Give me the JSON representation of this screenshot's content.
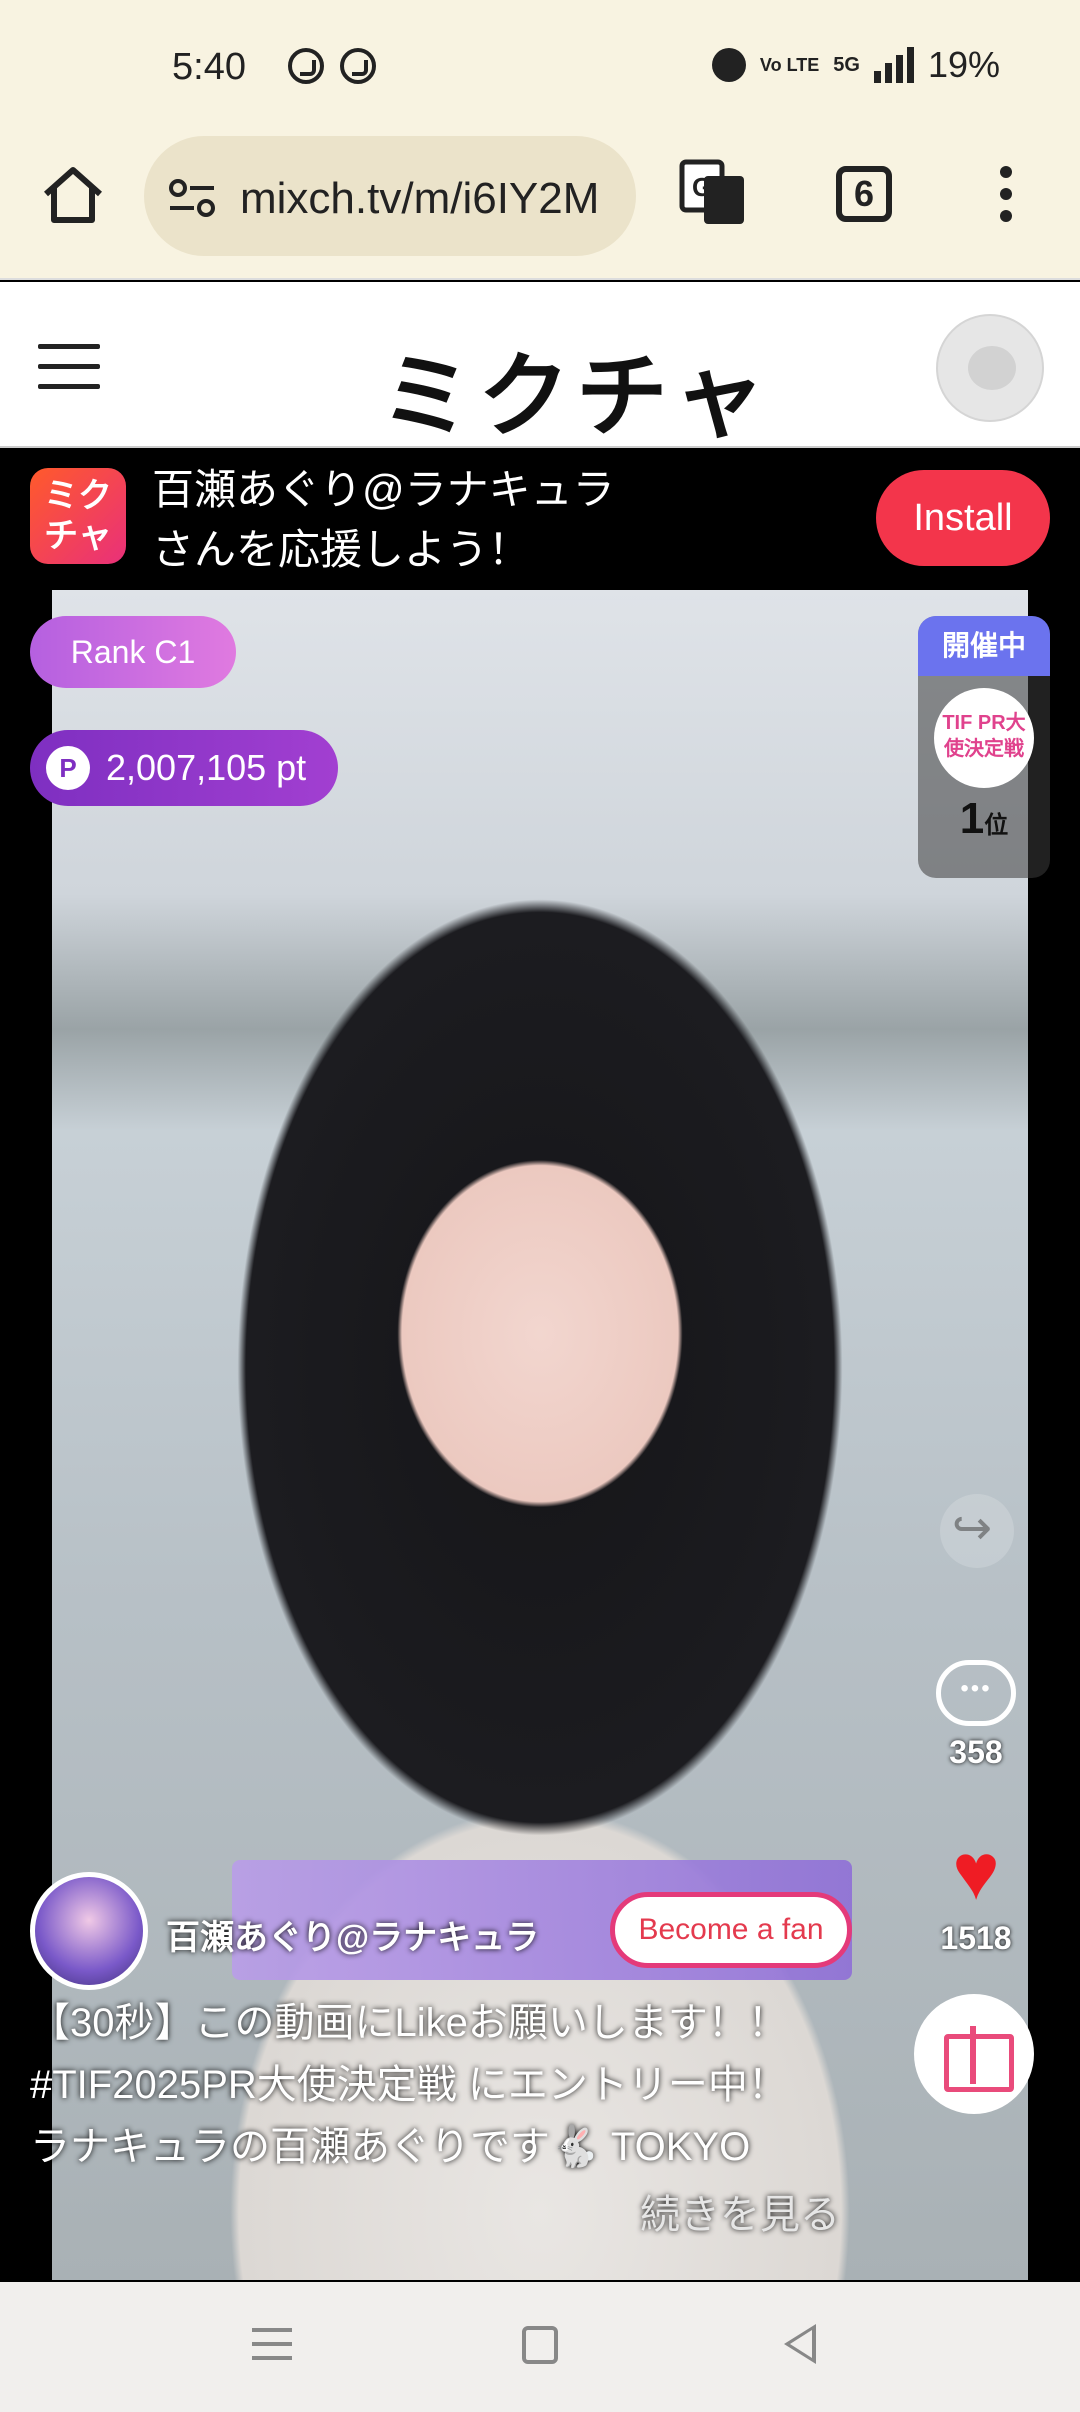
{
  "status_bar": {
    "time": "5:40",
    "network": "5G",
    "battery": "19%",
    "volte_label": "Vo LTE",
    "icons": [
      "whatsapp-icon",
      "whatsapp-icon",
      "alarm-icon",
      "volte-icon",
      "signal-icon"
    ]
  },
  "browser": {
    "url": "mixch.tv/m/i6IY2M",
    "tab_count": "6"
  },
  "site": {
    "logo_text": "ミクチャ"
  },
  "promo": {
    "app_icon_text": "ミクチャ",
    "message": "百瀬あぐり@ラナキュラさんを応援しよう！",
    "install_label": "Install"
  },
  "overlay": {
    "rank": "Rank C1",
    "points_icon": "P",
    "points": "2,007,105  pt",
    "event_status": "開催中",
    "event_logo": "TIF PR大使決定戦",
    "event_rank_num": "1",
    "event_rank_suffix": "位",
    "comment_count": "358",
    "like_count": "1518"
  },
  "creator": {
    "name": "百瀬あぐり@ラナキュラ",
    "fan_button": "Become a fan"
  },
  "caption": {
    "line1": "【30秒】この動画にLikeお願いします！！",
    "line2": "#TIF2025PR大使決定戦 にエントリー中！",
    "line3": "ラナキュラの百瀬あぐりです🐇 TOKYO",
    "more": "続きを見る"
  },
  "colors": {
    "install": "#f3354b",
    "rank_pill": "#b560e0",
    "points_pill": "#7e2fc1",
    "event_header": "#6b73ee",
    "heart": "#ef1c24",
    "fan_border": "#e43a7a"
  }
}
